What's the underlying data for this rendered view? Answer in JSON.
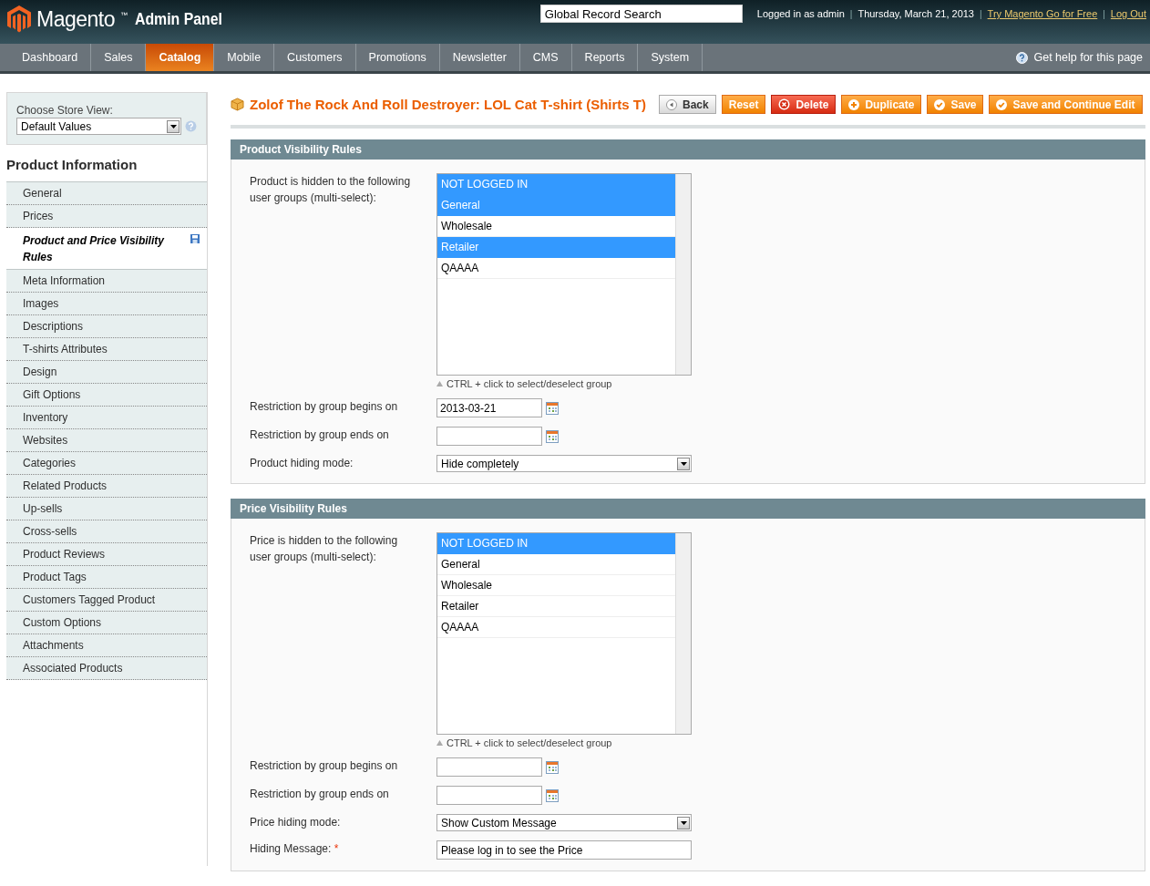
{
  "header": {
    "logo_word": "Magento",
    "logo_tm": "™",
    "logo_suffix": "Admin Panel",
    "search": {
      "placeholder": "Global Record Search"
    },
    "user": "Logged in as admin",
    "date": "Thursday, March 21, 2013",
    "links": [
      "Try Magento Go for Free",
      "Log Out"
    ],
    "separator": "|"
  },
  "nav": {
    "items": [
      {
        "label": "Dashboard",
        "selected": false
      },
      {
        "label": "Sales",
        "selected": false
      },
      {
        "label": "Catalog",
        "selected": true
      },
      {
        "label": "Mobile",
        "selected": false
      },
      {
        "label": "Customers",
        "selected": false
      },
      {
        "label": "Promotions",
        "selected": false
      },
      {
        "label": "Newsletter",
        "selected": false
      },
      {
        "label": "CMS",
        "selected": false
      },
      {
        "label": "Reports",
        "selected": false
      },
      {
        "label": "System",
        "selected": false
      }
    ],
    "help": "Get help for this page"
  },
  "sidebar": {
    "store_label": "Choose Store View:",
    "store_value": "Default Values",
    "heading": "Product Information",
    "items": [
      {
        "label": "General",
        "selected": false,
        "changed": false
      },
      {
        "label": "Prices",
        "selected": false,
        "changed": false
      },
      {
        "label": "Product and Price Visibility Rules",
        "selected": true,
        "changed": true
      },
      {
        "label": "Meta Information",
        "selected": false,
        "changed": false
      },
      {
        "label": "Images",
        "selected": false,
        "changed": false
      },
      {
        "label": "Descriptions",
        "selected": false,
        "changed": false
      },
      {
        "label": "T-shirts Attributes",
        "selected": false,
        "changed": false
      },
      {
        "label": "Design",
        "selected": false,
        "changed": false
      },
      {
        "label": "Gift Options",
        "selected": false,
        "changed": false
      },
      {
        "label": "Inventory",
        "selected": false,
        "changed": false
      },
      {
        "label": "Websites",
        "selected": false,
        "changed": false
      },
      {
        "label": "Categories",
        "selected": false,
        "changed": false
      },
      {
        "label": "Related Products",
        "selected": false,
        "changed": false
      },
      {
        "label": "Up-sells",
        "selected": false,
        "changed": false
      },
      {
        "label": "Cross-sells",
        "selected": false,
        "changed": false
      },
      {
        "label": "Product Reviews",
        "selected": false,
        "changed": false
      },
      {
        "label": "Product Tags",
        "selected": false,
        "changed": false
      },
      {
        "label": "Customers Tagged Product",
        "selected": false,
        "changed": false
      },
      {
        "label": "Custom Options",
        "selected": false,
        "changed": false
      },
      {
        "label": "Attachments",
        "selected": false,
        "changed": false
      },
      {
        "label": "Associated Products",
        "selected": false,
        "changed": false
      }
    ]
  },
  "page": {
    "title": "Zolof The Rock And Roll Destroyer: LOL Cat T-shirt (Shirts T)",
    "buttons": [
      {
        "label": "Back",
        "kind": "back"
      },
      {
        "label": "Reset",
        "kind": "plain"
      },
      {
        "label": "Delete",
        "kind": "delete"
      },
      {
        "label": "Duplicate",
        "kind": "add"
      },
      {
        "label": "Save",
        "kind": "save"
      },
      {
        "label": "Save and Continue Edit",
        "kind": "save"
      }
    ]
  },
  "sections": [
    {
      "title": "Product Visibility Rules",
      "fields": [
        {
          "kind": "multiselect",
          "label": "Product is hidden to the following user groups (multi-select):",
          "options": [
            {
              "label": "NOT LOGGED IN",
              "selected": true
            },
            {
              "label": "General",
              "selected": true
            },
            {
              "label": "Wholesale",
              "selected": false
            },
            {
              "label": "Retailer",
              "selected": true
            },
            {
              "label": "QAAAA",
              "selected": false
            }
          ],
          "note": "CTRL + click to select/deselect group"
        },
        {
          "kind": "date",
          "label": "Restriction by group begins on",
          "value": "2013-03-21"
        },
        {
          "kind": "date",
          "label": "Restriction by group ends on"
        },
        {
          "kind": "select",
          "label": "Product hiding mode:",
          "value": "Hide completely"
        }
      ]
    },
    {
      "title": "Price Visibility Rules",
      "fields": [
        {
          "kind": "multiselect",
          "label": "Price is hidden to the following user groups (multi-select):",
          "options": [
            {
              "label": "NOT LOGGED IN",
              "selected": true
            },
            {
              "label": "General",
              "selected": false
            },
            {
              "label": "Wholesale",
              "selected": false
            },
            {
              "label": "Retailer",
              "selected": false
            },
            {
              "label": "QAAAA",
              "selected": false
            }
          ],
          "note": "CTRL + click to select/deselect group"
        },
        {
          "kind": "date",
          "label": "Restriction by group begins on"
        },
        {
          "kind": "date",
          "label": "Restriction by group ends on"
        },
        {
          "kind": "select",
          "label": "Price hiding mode:",
          "value": "Show Custom Message"
        },
        {
          "kind": "text",
          "label": "Hiding Message:",
          "required_mark": "*",
          "value": "Please log in to see the Price"
        }
      ]
    }
  ]
}
